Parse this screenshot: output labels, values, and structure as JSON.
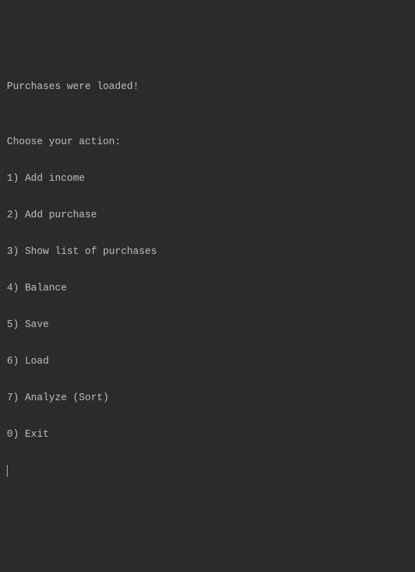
{
  "status_line": "Purchases were loaded!",
  "blank": "",
  "prompt_header": "Choose your action:",
  "menu": {
    "items": [
      "1) Add income",
      "2) Add purchase",
      "3) Show list of purchases",
      "4) Balance",
      "5) Save",
      "6) Load",
      "7) Analyze (Sort)",
      "0) Exit"
    ]
  }
}
